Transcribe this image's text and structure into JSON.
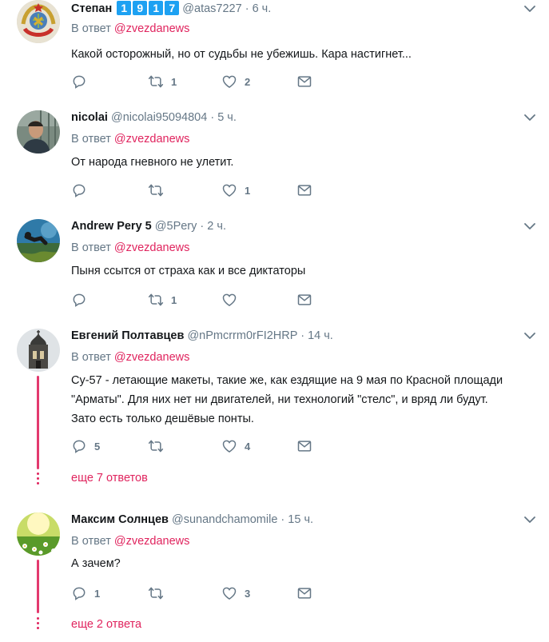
{
  "colors": {
    "accent": "#e0245e",
    "muted": "#657786",
    "icon": "#657786",
    "badge": "#1da1f2"
  },
  "tweets": [
    {
      "name": "Степан",
      "badges": [
        "1",
        "9",
        "1",
        "7"
      ],
      "handle": "@atas7227",
      "time": "6 ч.",
      "reply_prefix": "В ответ",
      "reply_mention": "@zvezdanews",
      "text": "Какой осторожный, но от судьбы не убежишь. Кара настигнет...",
      "replies": "",
      "retweets": "1",
      "likes": "2",
      "avatar": "soviet-emblem"
    },
    {
      "name": "nicolai",
      "handle": "@nicolai95094804",
      "time": "5 ч.",
      "reply_prefix": "В ответ",
      "reply_mention": "@zvezdanews",
      "text": "От народа гневного не улетит.",
      "replies": "",
      "retweets": "",
      "likes": "1",
      "avatar": "man-photo"
    },
    {
      "name": "Andrew Pery 5",
      "handle": "@5Pery",
      "time": "2 ч.",
      "reply_prefix": "В ответ",
      "reply_mention": "@zvezdanews",
      "text": "Пыня ссытся от страха как и все диктаторы",
      "replies": "",
      "retweets": "1",
      "likes": "",
      "avatar": "diver-photo"
    },
    {
      "name": "Евгений Полтавцев",
      "handle": "@nPmcrrm0rFI2HRP",
      "time": "14 ч.",
      "reply_prefix": "В ответ",
      "reply_mention": "@zvezdanews",
      "text": "Су-57 - летающие макеты, такие же, как ездящие на 9 мая по Красной площади \"Арматы\". Для них нет ни двигателей, ни технологий \"стелс\", и вряд ли будут. Зато есть только дешёвые понты.",
      "replies": "5",
      "retweets": "",
      "likes": "4",
      "more": "еще 7 ответов",
      "avatar": "church-photo"
    },
    {
      "name": "Максим Солнцев",
      "handle": "@sunandchamomile",
      "time": "15 ч.",
      "reply_prefix": "В ответ",
      "reply_mention": "@zvezdanews",
      "text": "А зачем?",
      "replies": "1",
      "retweets": "",
      "likes": "3",
      "more": "еще 2 ответа",
      "avatar": "chamomile-field-photo"
    }
  ]
}
